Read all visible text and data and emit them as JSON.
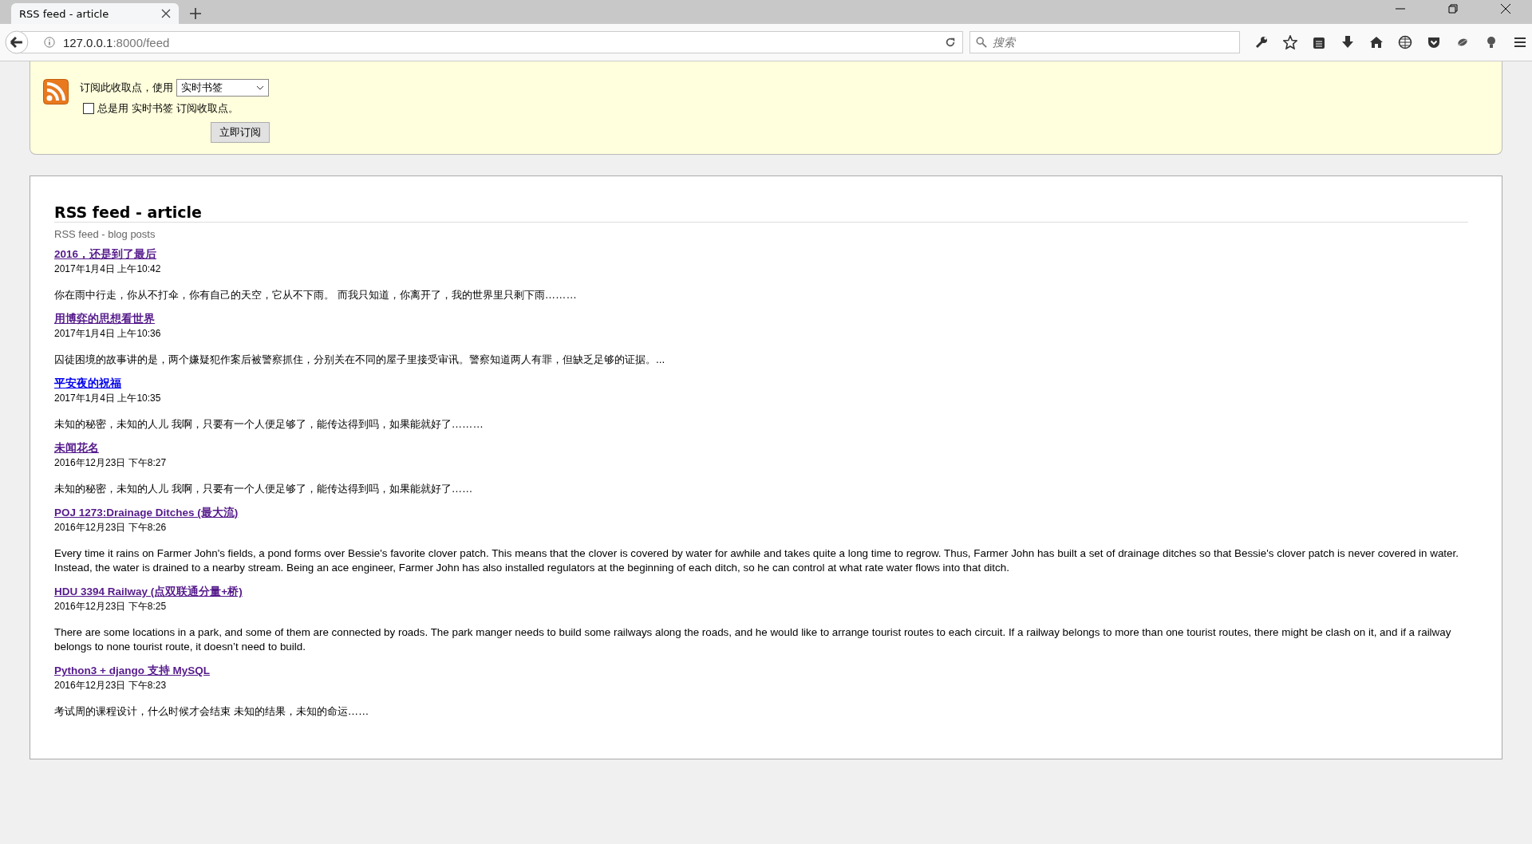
{
  "browser": {
    "tab": {
      "title": "RSS feed - article",
      "selected": true
    },
    "address": {
      "host": "127.0.0.1",
      "rest": ":8000/feed"
    },
    "search": {
      "placeholder": "搜索"
    }
  },
  "subscribe": {
    "label": "订阅此收取点，使用",
    "reader": "实时书签",
    "always": {
      "label": "总是用 实时书签 订阅收取点。",
      "checked": false
    },
    "button": "立即订阅"
  },
  "feed": {
    "title": "RSS feed - article",
    "subtitle": "RSS feed - blog posts",
    "entries": [
      {
        "title": "2016，还是到了最后",
        "visited": true,
        "date": "2017年1月4日 上午10:42",
        "summary": "你在雨中行走，你从不打伞，你有自己的天空，它从不下雨。 而我只知道，你离开了，我的世界里只剩下雨………"
      },
      {
        "title": "用博弈的思想看世界",
        "visited": true,
        "date": "2017年1月4日 上午10:36",
        "summary": "囚徒困境的故事讲的是，两个嫌疑犯作案后被警察抓住，分别关在不同的屋子里接受审讯。警察知道两人有罪，但缺乏足够的证据。..."
      },
      {
        "title": "平安夜的祝福",
        "visited": false,
        "date": "2017年1月4日 上午10:35",
        "summary": "未知的秘密，未知的人儿 我啊，只要有一个人便足够了，能传达得到吗，如果能就好了………"
      },
      {
        "title": "未闻花名",
        "visited": true,
        "date": "2016年12月23日 下午8:27",
        "summary": "未知的秘密，未知的人儿 我啊，只要有一个人便足够了，能传达得到吗，如果能就好了……"
      },
      {
        "title": "POJ 1273:Drainage Ditches (最大流)",
        "visited": true,
        "date": "2016年12月23日 下午8:26",
        "summary": "Every time it rains on Farmer John's fields, a pond forms over Bessie's favorite clover patch. This means that the clover is covered by water for awhile and takes quite a long time to regrow. Thus, Farmer John has built a set of drainage ditches so that Bessie's clover patch is never covered in water. Instead, the water is drained to a nearby stream. Being an ace engineer, Farmer John has also installed regulators at the beginning of each ditch, so he can control at what rate water flows into that ditch."
      },
      {
        "title": "HDU 3394 Railway (点双联通分量+桥)",
        "visited": true,
        "date": "2016年12月23日 下午8:25",
        "summary": "There are some locations in a park, and some of them are connected by roads. The park manger needs to build some railways along the roads, and he would like to arrange tourist routes to each circuit. If a railway belongs to more than one tourist routes, there might be clash on it, and if a railway belongs to none tourist route, it doesn’t need to build."
      },
      {
        "title": "Python3 + django 支持 MySQL",
        "visited": true,
        "date": "2016年12月23日 下午8:23",
        "summary": "考试周的课程设计，什么时候才会结束 未知的结果，未知的命运……"
      }
    ]
  }
}
